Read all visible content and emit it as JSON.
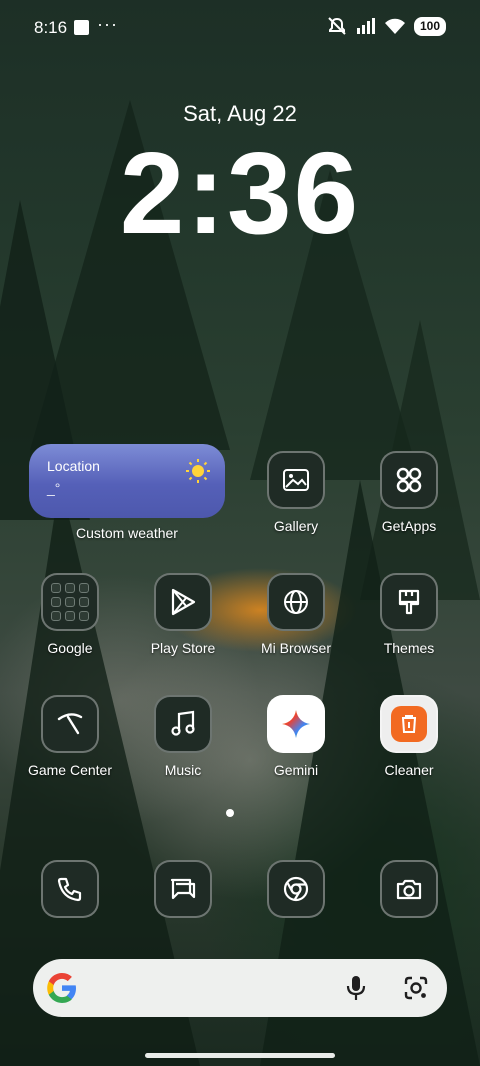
{
  "status_bar": {
    "time": "8:16",
    "overflow": "···",
    "battery": "100",
    "icons": [
      "mute-icon",
      "signal-icon",
      "wifi-icon",
      "battery-icon"
    ]
  },
  "lock": {
    "date": "Sat, Aug 22",
    "time": "2:36"
  },
  "weather_widget": {
    "location": "Location",
    "temperature": "_°",
    "label": "Custom weather",
    "icon": "sun-icon"
  },
  "apps": {
    "gallery": "Gallery",
    "getapps": "GetApps",
    "google": "Google",
    "play_store": "Play Store",
    "mi_browser": "Mi Browser",
    "themes": "Themes",
    "game_center": "Game Center",
    "music": "Music",
    "gemini": "Gemini",
    "cleaner": "Cleaner"
  },
  "dock": [
    "phone-icon",
    "messages-icon",
    "chrome-icon",
    "camera-icon"
  ],
  "search_bar": {
    "icons": [
      "google-logo-icon",
      "mic-icon",
      "lens-icon"
    ]
  },
  "colors": {
    "icon_bg": "#1f2b25",
    "weather_top": "#7d8cd6",
    "weather_bottom": "#4d58ad",
    "search_bg": "#eef0ee"
  }
}
